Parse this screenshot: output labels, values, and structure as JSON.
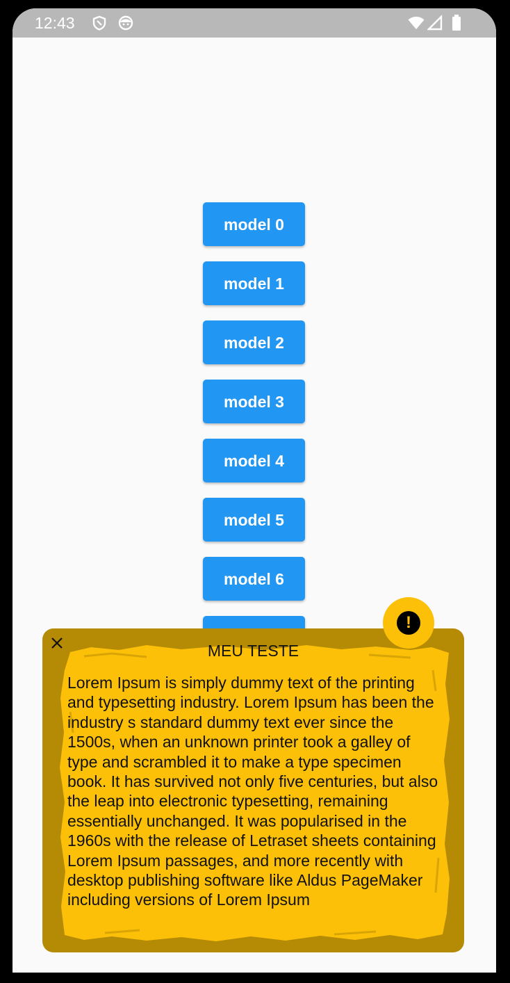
{
  "status_bar": {
    "time": "12:43",
    "icons_left": [
      "shield-icon",
      "face-icon"
    ],
    "icons_right": [
      "wifi-icon",
      "signal-icon",
      "battery-icon"
    ]
  },
  "buttons": [
    {
      "label": "model 0"
    },
    {
      "label": "model 1"
    },
    {
      "label": "model 2"
    },
    {
      "label": "model 3"
    },
    {
      "label": "model 4"
    },
    {
      "label": "model 5"
    },
    {
      "label": "model 6"
    },
    {
      "label": ""
    }
  ],
  "alert": {
    "title": "MEU TESTE",
    "body": "Lorem Ipsum is simply dummy text of the printing and typesetting industry. Lorem Ipsum has been the industry s standard dummy text ever since the 1500s, when an unknown printer took a galley of type and scrambled it to make a type specimen book. It has survived not only five centuries, but also the leap into electronic typesetting, remaining essentially unchanged. It was popularised in the 1960s with the release of Letraset sheets containing Lorem Ipsum passages, and more recently with desktop publishing software like Aldus PageMaker including versions of Lorem Ipsum",
    "close_icon": "close-icon",
    "badge_icon": "exclamation-icon",
    "colors": {
      "accent": "#fdc008",
      "frame": "#b58a05"
    }
  },
  "colors": {
    "button": "#2196f3",
    "statusbar": "#b8b8b8",
    "background": "#fafafa"
  }
}
